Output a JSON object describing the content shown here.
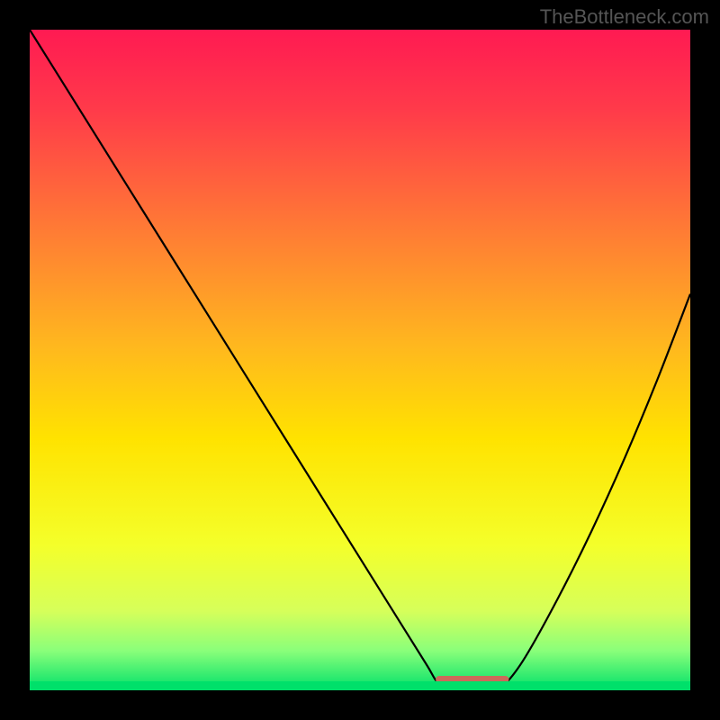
{
  "watermark": "TheBottleneck.com",
  "chart_data": {
    "type": "line",
    "title": "",
    "xlabel": "",
    "ylabel": "",
    "xlim": [
      0,
      100
    ],
    "ylim": [
      0,
      100
    ],
    "series": [
      {
        "name": "bottleneck-curve",
        "x": [
          0,
          5,
          10,
          15,
          20,
          25,
          30,
          35,
          40,
          45,
          50,
          55,
          60,
          62,
          65,
          68,
          70,
          72,
          75,
          80,
          85,
          90,
          95,
          100
        ],
        "values": [
          100,
          92,
          84,
          76,
          68,
          60,
          52,
          44,
          36,
          28,
          20,
          12,
          4,
          1,
          0,
          0,
          0,
          1,
          5,
          14,
          24,
          35,
          47,
          60
        ]
      },
      {
        "name": "optimal-segment",
        "x": [
          62,
          72
        ],
        "values": [
          0,
          0
        ]
      }
    ],
    "gradient_stops": [
      {
        "pos": 0.0,
        "color": "#ff1a52"
      },
      {
        "pos": 0.12,
        "color": "#ff3a4a"
      },
      {
        "pos": 0.3,
        "color": "#ff7a35"
      },
      {
        "pos": 0.48,
        "color": "#ffb81e"
      },
      {
        "pos": 0.62,
        "color": "#ffe300"
      },
      {
        "pos": 0.78,
        "color": "#f4ff2a"
      },
      {
        "pos": 0.88,
        "color": "#d6ff5a"
      },
      {
        "pos": 0.94,
        "color": "#8aff7a"
      },
      {
        "pos": 1.0,
        "color": "#00e06a"
      }
    ],
    "curve_color": "#000000",
    "optimal_color": "#cc6a5a"
  }
}
